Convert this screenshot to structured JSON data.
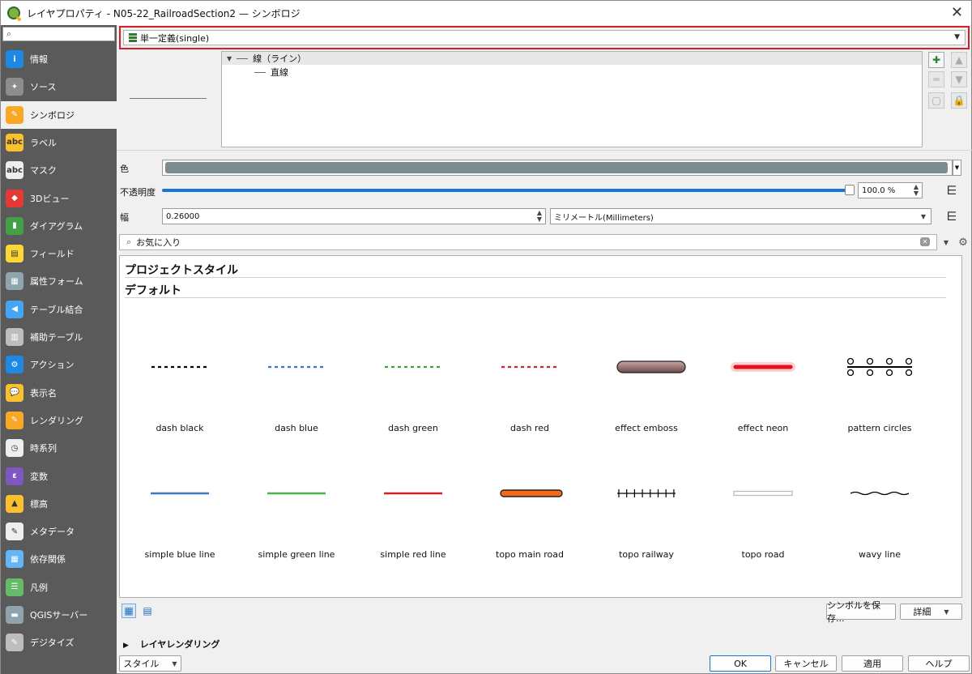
{
  "window": {
    "title": "レイヤプロパティ - N05-22_RailroadSection2 — シンボロジ",
    "close_glyph": "✕"
  },
  "sidebar": {
    "search_placeholder": "",
    "items": [
      {
        "label": "情報",
        "icon": "info-icon",
        "color": "#1e88e5",
        "glyph": "i"
      },
      {
        "label": "ソース",
        "icon": "source-wrench-icon",
        "color": "#8d8d8d",
        "glyph": "✦"
      },
      {
        "label": "シンボロジ",
        "icon": "symbology-brush-icon",
        "color": "#f9a825",
        "glyph": "✎",
        "selected": true
      },
      {
        "label": "ラベル",
        "icon": "label-abc-icon",
        "color": "#fbc02d",
        "glyph": "abc"
      },
      {
        "label": "マスク",
        "icon": "mask-abc-icon",
        "color": "#eeeeee",
        "glyph": "abc"
      },
      {
        "label": "3Dビュー",
        "icon": "3d-cube-icon",
        "color": "#e53935",
        "glyph": "◆"
      },
      {
        "label": "ダイアグラム",
        "icon": "diagram-icon",
        "color": "#43a047",
        "glyph": "▮"
      },
      {
        "label": "フィールド",
        "icon": "fields-icon",
        "color": "#fdd835",
        "glyph": "▤"
      },
      {
        "label": "属性フォーム",
        "icon": "attribute-form-icon",
        "color": "#90a4ae",
        "glyph": "▦"
      },
      {
        "label": "テーブル結合",
        "icon": "join-icon",
        "color": "#42a5f5",
        "glyph": "◀"
      },
      {
        "label": "補助テーブル",
        "icon": "auxiliary-storage-icon",
        "color": "#bdbdbd",
        "glyph": "▥"
      },
      {
        "label": "アクション",
        "icon": "action-gear-icon",
        "color": "#1e88e5",
        "glyph": "⚙"
      },
      {
        "label": "表示名",
        "icon": "display-bubble-icon",
        "color": "#fbc02d",
        "glyph": "💬"
      },
      {
        "label": "レンダリング",
        "icon": "rendering-brush-icon",
        "color": "#f9a825",
        "glyph": "✎"
      },
      {
        "label": "時系列",
        "icon": "temporal-clock-icon",
        "color": "#eeeeee",
        "glyph": "◷"
      },
      {
        "label": "変数",
        "icon": "variables-icon",
        "color": "#7e57c2",
        "glyph": "ε"
      },
      {
        "label": "標高",
        "icon": "elevation-icon",
        "color": "#fbc02d",
        "glyph": "▲"
      },
      {
        "label": "メタデータ",
        "icon": "metadata-icon",
        "color": "#eeeeee",
        "glyph": "✎"
      },
      {
        "label": "依存関係",
        "icon": "dependencies-icon",
        "color": "#64b5f6",
        "glyph": "▦"
      },
      {
        "label": "凡例",
        "icon": "legend-icon",
        "color": "#66bb6a",
        "glyph": "☰"
      },
      {
        "label": "QGISサーバー",
        "icon": "server-icon",
        "color": "#90a4ae",
        "glyph": "▬"
      },
      {
        "label": "デジタイズ",
        "icon": "digitizing-icon",
        "color": "#bdbdbd",
        "glyph": "✎"
      }
    ]
  },
  "renderer": {
    "selected": "単一定義(single)"
  },
  "symbol_tree": {
    "root": "線（ライン）",
    "child": "直線"
  },
  "fields": {
    "color_label": "色",
    "color_value": "#7c8b8b",
    "opacity_label": "不透明度",
    "opacity_value": "100.0 %",
    "width_label": "幅",
    "width_value": "0.26000",
    "unit_value": "ミリメートル(Millimeters)"
  },
  "library": {
    "search_value": "お気に入り",
    "section1": "プロジェクトスタイル",
    "section2": "デフォルト",
    "symbols": [
      {
        "name": "dash  black",
        "style": "dash",
        "color": "#000000"
      },
      {
        "name": "dash blue",
        "style": "dash",
        "color": "#3a78c2"
      },
      {
        "name": "dash green",
        "style": "dash",
        "color": "#3aa040"
      },
      {
        "name": "dash red",
        "style": "dash",
        "color": "#d0202a"
      },
      {
        "name": "effect emboss",
        "style": "emboss",
        "color": "#6b4a4a"
      },
      {
        "name": "effect neon",
        "style": "neon",
        "color": "#e01020"
      },
      {
        "name": "pattern circles",
        "style": "circles",
        "color": "#000000"
      },
      {
        "name": "simple blue line",
        "style": "solid",
        "color": "#3a78c2"
      },
      {
        "name": "simple green line",
        "style": "solid",
        "color": "#4ab548"
      },
      {
        "name": "simple red line",
        "style": "solid",
        "color": "#d0202a"
      },
      {
        "name": "topo main road",
        "style": "mainroad",
        "color": "#f26b1d"
      },
      {
        "name": "topo railway",
        "style": "railway",
        "color": "#000000"
      },
      {
        "name": "topo road",
        "style": "road",
        "color": "#bdbdbd"
      },
      {
        "name": "wavy line",
        "style": "wavy",
        "color": "#000000"
      }
    ]
  },
  "buttons": {
    "save_symbol": "シンボルを保存...",
    "advanced": "詳細",
    "layer_rendering": "レイヤレンダリング",
    "style": "スタイル",
    "ok": "OK",
    "cancel": "キャンセル",
    "apply": "適用",
    "help": "ヘルプ"
  }
}
